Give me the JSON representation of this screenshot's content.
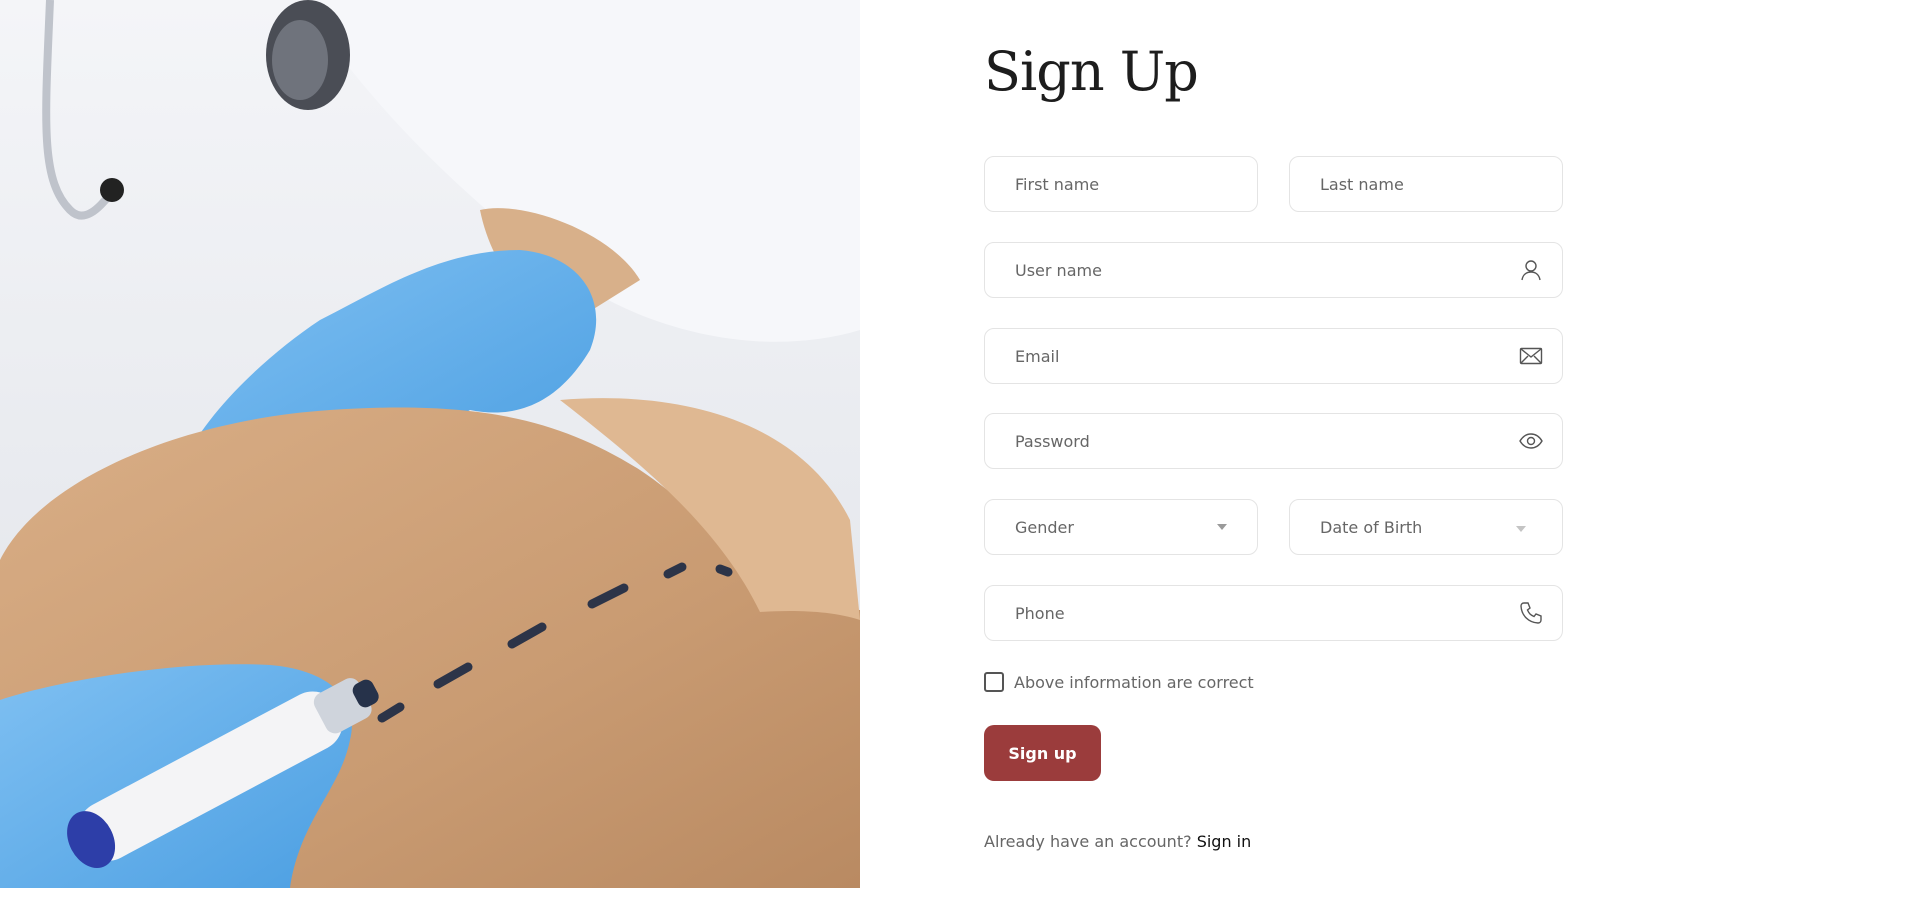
{
  "form": {
    "title": "Sign Up",
    "first_name": {
      "placeholder": "First name"
    },
    "last_name": {
      "placeholder": "Last name"
    },
    "user_name": {
      "placeholder": "User name",
      "icon": "user-icon"
    },
    "email": {
      "placeholder": "Email",
      "icon": "mail-icon"
    },
    "password": {
      "placeholder": "Password",
      "icon": "eye-icon"
    },
    "gender": {
      "label": "Gender",
      "icon": "chevron-down-icon"
    },
    "date_of_birth": {
      "label": "Date of Birth",
      "icon": "chevron-down-icon"
    },
    "phone": {
      "placeholder": "Phone",
      "icon": "phone-icon"
    },
    "confirm_checkbox": {
      "label": "Above information are correct",
      "checked": false
    },
    "submit_label": "Sign up",
    "signin_prompt": "Already have an account?",
    "signin_link": "Sign in"
  },
  "colors": {
    "primary_button": "#9b3c3c",
    "field_border": "#e4e4e4",
    "title_text": "#1d1d1d"
  }
}
